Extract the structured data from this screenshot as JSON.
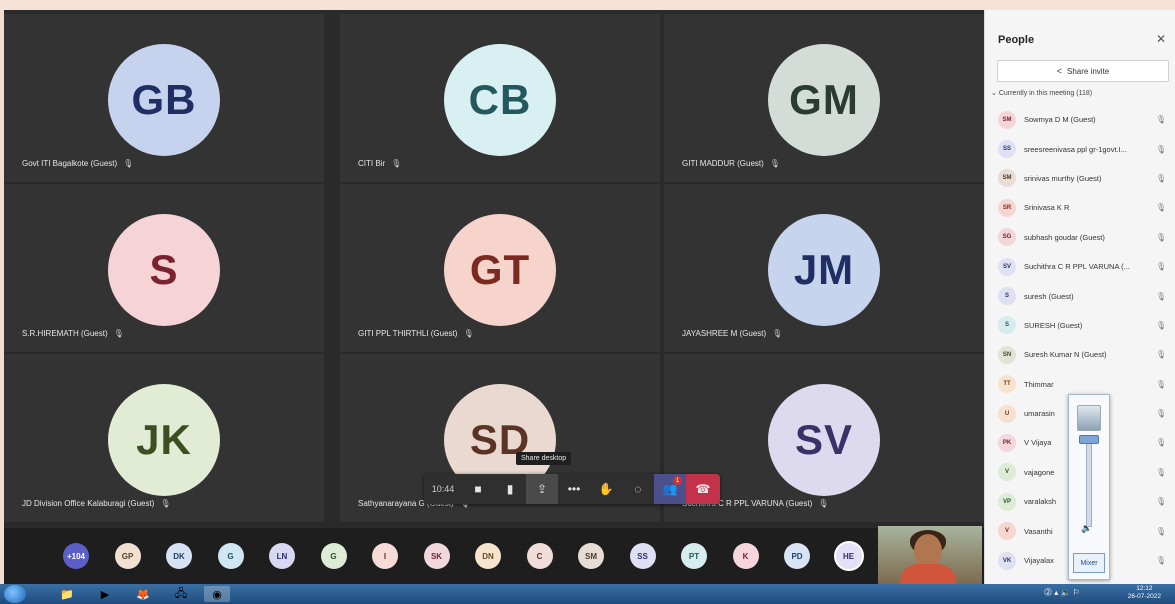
{
  "tiles": [
    {
      "initials": "GB",
      "name": "Govt ITI Bagalkote (Guest)",
      "bg": "#c6d3ee",
      "fg": "#1f2f63"
    },
    {
      "initials": "CB",
      "name": "CITI Bir",
      "bg": "#d9f0f2",
      "fg": "#24585f"
    },
    {
      "initials": "GM",
      "name": "GITI MADDUR (Guest)",
      "bg": "#d4dcd8",
      "fg": "#2b3a33"
    },
    {
      "initials": "S",
      "name": "S.R.HIREMATH (Guest)",
      "bg": "#f5d3d6",
      "fg": "#7a2230"
    },
    {
      "initials": "GT",
      "name": "GITI PPL THIRTHLI (Guest)",
      "bg": "#f6d3cb",
      "fg": "#7a2a1e"
    },
    {
      "initials": "JM",
      "name": "JAYASHREE M (Guest)",
      "bg": "#c6d4ee",
      "fg": "#1f2f63"
    },
    {
      "initials": "JK",
      "name": "JD Division Office Kalaburagi (Guest)",
      "bg": "#e2ecd4",
      "fg": "#3c4f22"
    },
    {
      "initials": "SD",
      "name": "Sathyanarayana G (Guest)",
      "bg": "#ead9d0",
      "fg": "#5a3526"
    },
    {
      "initials": "SV",
      "name": "Suchithra C R PPL VARUNA (Guest)",
      "bg": "#ddd9ee",
      "fg": "#3a3266"
    }
  ],
  "controls": {
    "time": "10:44",
    "tooltip": "Share desktop",
    "people_badge": "1"
  },
  "bottom_avatars": [
    {
      "t": "+104",
      "bg": "#5b5fc7",
      "fg": "#ffffff"
    },
    {
      "t": "GP",
      "bg": "#f0e0d2",
      "fg": "#5a3c24"
    },
    {
      "t": "DK",
      "bg": "#d6e2f4",
      "fg": "#1f3f66"
    },
    {
      "t": "G",
      "bg": "#d0e6f2",
      "fg": "#1f4f66"
    },
    {
      "t": "LN",
      "bg": "#d7d8f2",
      "fg": "#2a2e70"
    },
    {
      "t": "G",
      "bg": "#dcecd6",
      "fg": "#2f5022"
    },
    {
      "t": "I",
      "bg": "#f6dbd6",
      "fg": "#7a2a20"
    },
    {
      "t": "SK",
      "bg": "#f2d8dc",
      "fg": "#6f2233"
    },
    {
      "t": "DN",
      "bg": "#f6e4cf",
      "fg": "#6a4a20"
    },
    {
      "t": "C",
      "bg": "#f0dcd8",
      "fg": "#5a2f26"
    },
    {
      "t": "SM",
      "bg": "#e8ddd4",
      "fg": "#4d3a2a"
    },
    {
      "t": "SS",
      "bg": "#dfe0f2",
      "fg": "#2f3070"
    },
    {
      "t": "PT",
      "bg": "#d7ecef",
      "fg": "#1f5560"
    },
    {
      "t": "K",
      "bg": "#f6d6dc",
      "fg": "#7a2233"
    },
    {
      "t": "PD",
      "bg": "#d8e4f4",
      "fg": "#1f3f66"
    },
    {
      "t": "HE",
      "bg": "#e4e1f6",
      "fg": "#2f2f70"
    }
  ],
  "panel": {
    "title": "People",
    "share_label": "Share invite",
    "current_label": "Currently in this meeting (118)",
    "people": [
      {
        "i": "SM",
        "n": "Sowmya D M (Guest)",
        "bg": "#f4d6da",
        "fg": "#7a2233"
      },
      {
        "i": "SS",
        "n": "sreesreenivasa ppl gr-1govt.I...",
        "bg": "#dfe0f2",
        "fg": "#2f3070"
      },
      {
        "i": "SM",
        "n": "srinivas murthy (Guest)",
        "bg": "#e8ddd4",
        "fg": "#4d3a2a"
      },
      {
        "i": "SR",
        "n": "Srinivasa K R",
        "bg": "#f6d6d0",
        "fg": "#7a2a1e"
      },
      {
        "i": "SG",
        "n": "subhash goudar (Guest)",
        "bg": "#f2d6d8",
        "fg": "#6f2233"
      },
      {
        "i": "SV",
        "n": "Suchithra C R PPL VARUNA (...",
        "bg": "#dfe0f2",
        "fg": "#2f3070"
      },
      {
        "i": "S",
        "n": "suresh (Guest)",
        "bg": "#dfe0f2",
        "fg": "#2f3070"
      },
      {
        "i": "S",
        "n": "SURESH (Guest)",
        "bg": "#d6ecef",
        "fg": "#1f5560"
      },
      {
        "i": "SN",
        "n": "Suresh Kumar N (Guest)",
        "bg": "#e0e4d6",
        "fg": "#3c4a22"
      },
      {
        "i": "TT",
        "n": "Thimmar",
        "bg": "#f6e4cf",
        "fg": "#6a4a20"
      },
      {
        "i": "U",
        "n": "umarasin",
        "bg": "#f6e0d0",
        "fg": "#6a3a20"
      },
      {
        "i": "PK",
        "n": "V Vijaya",
        "bg": "#f4d6dc",
        "fg": "#7a2233"
      },
      {
        "i": "V",
        "n": "vajagone",
        "bg": "#dcecd6",
        "fg": "#2f5022"
      },
      {
        "i": "VP",
        "n": "varalaksh",
        "bg": "#dcecd6",
        "fg": "#2f5022"
      },
      {
        "i": "V",
        "n": "Vasanthi",
        "bg": "#f6d6d0",
        "fg": "#7a2a1e"
      },
      {
        "i": "VK",
        "n": "Vijayalax",
        "bg": "#dfe0f2",
        "fg": "#2f3070"
      }
    ]
  },
  "mixer": {
    "label": "Mixer"
  },
  "taskbar": {
    "time": "12:12",
    "date": "26-07-2022"
  }
}
